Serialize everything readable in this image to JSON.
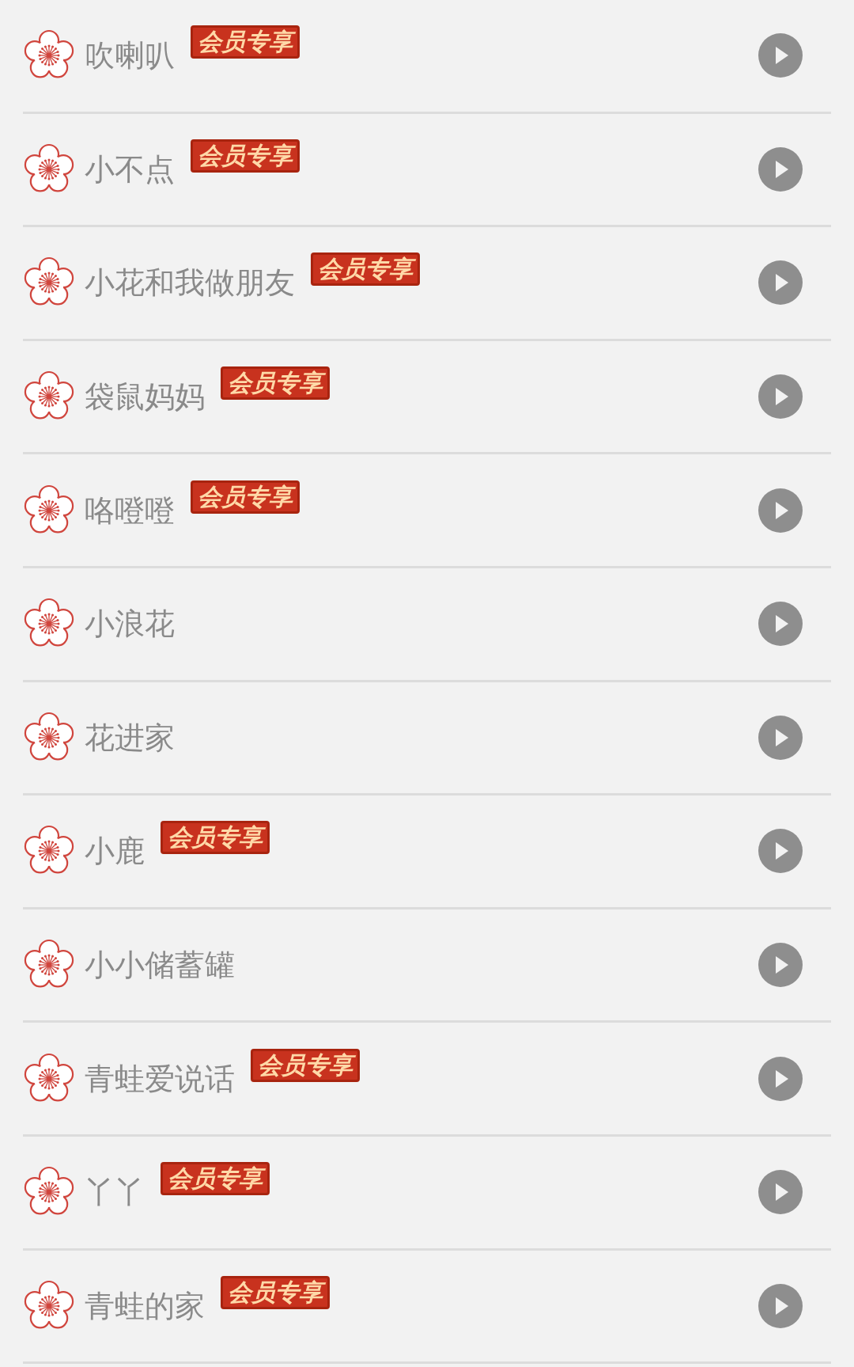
{
  "songs": [
    {
      "title": "吹喇叭",
      "badge": "会员专享"
    },
    {
      "title": "小不点",
      "badge": "会员专享"
    },
    {
      "title": "小花和我做朋友",
      "badge": "会员专享"
    },
    {
      "title": "袋鼠妈妈",
      "badge": "会员专享"
    },
    {
      "title": "咯噔噔",
      "badge": "会员专享"
    },
    {
      "title": "小浪花"
    },
    {
      "title": "花进家"
    },
    {
      "title": "小鹿",
      "badge": "会员专享"
    },
    {
      "title": "小小储蓄罐"
    },
    {
      "title": "青蛙爱说话",
      "badge": "会员专享"
    },
    {
      "title": "丫丫",
      "badge": "会员专享"
    },
    {
      "title": "青蛙的家",
      "badge": "会员专享"
    }
  ]
}
